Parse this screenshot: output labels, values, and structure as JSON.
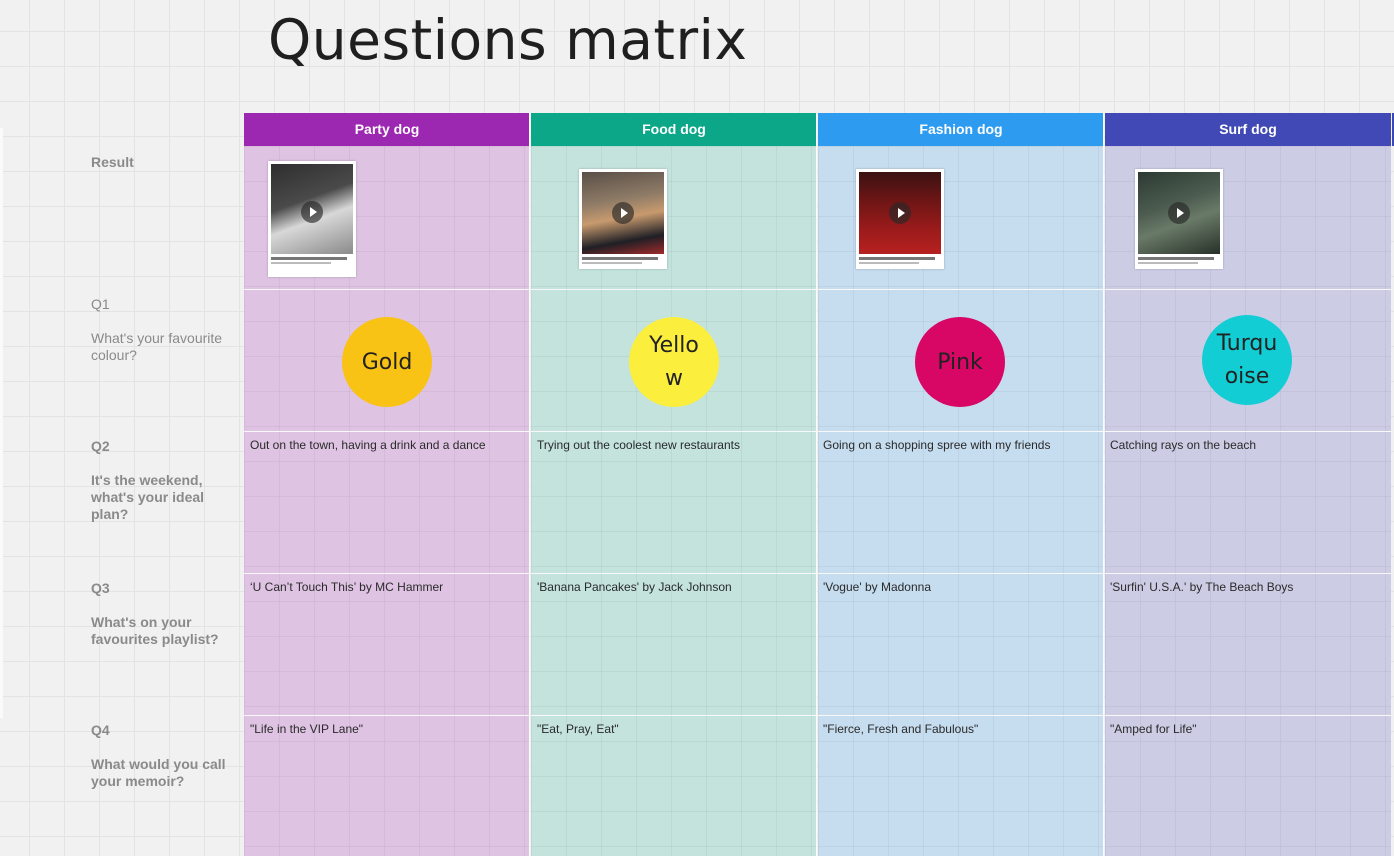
{
  "title": "Questions matrix",
  "columns": [
    {
      "name": "Party dog",
      "header_color": "#9c27b0",
      "body_color": "#dfc3e3",
      "circle_label": "Gold",
      "circle_color": "#f8c314",
      "q2": "Out on the town, having a drink and a dance",
      "q3": "‘U Can’t Touch This’ by MC Hammer",
      "q4": "\"Life in the VIP Lane\""
    },
    {
      "name": "Food dog",
      "header_color": "#0ca789",
      "body_color": "#c3e3dc",
      "circle_label": "Yellow",
      "circle_color": "#fbee3d",
      "q2": "Trying out the coolest new restaurants",
      "q3": "'Banana Pancakes' by Jack Johnson",
      "q4": "\"Eat, Pray, Eat\""
    },
    {
      "name": "Fashion dog",
      "header_color": "#2d9bf0",
      "body_color": "#c6dcef",
      "circle_label": "Pink",
      "circle_color": "#d80766",
      "q2": "Going on a shopping spree with my friends",
      "q3": "'Vogue' by Madonna",
      "q4": "\"Fierce, Fresh and Fabulous\""
    },
    {
      "name": "Surf dog",
      "header_color": "#4149b6",
      "body_color": "#cccde5",
      "circle_label": "Turquoise",
      "circle_color": "#13cdd4",
      "q2": "Catching rays on the beach",
      "q3": "'Surfin' U.S.A.' by The Beach Boys",
      "q4": "\"Amped for Life\""
    }
  ],
  "rows": {
    "result": "Result",
    "q1_id": "Q1",
    "q1_text": "What's your favourite colour?",
    "q2_id": "Q2",
    "q2_text": "It's the weekend, what's your ideal plan?",
    "q3_id": "Q3",
    "q3_text": "What's on your favourites playlist?",
    "q4_id": "Q4",
    "q4_text": "What would you call your memoir?"
  },
  "thumb_icon": "play-icon"
}
